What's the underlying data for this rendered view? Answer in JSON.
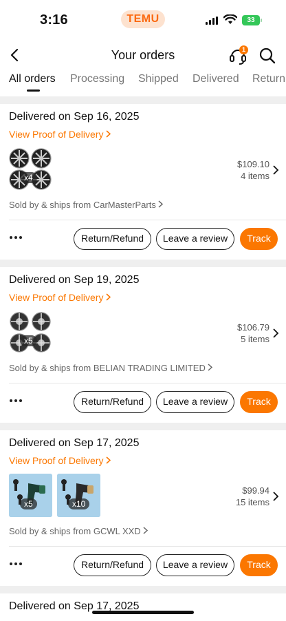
{
  "status": {
    "time": "3:16",
    "brand": "TEMU",
    "battery": "33"
  },
  "header": {
    "title": "Your orders",
    "notification_count": "1"
  },
  "tabs": [
    {
      "label": "All orders",
      "active": true
    },
    {
      "label": "Processing"
    },
    {
      "label": "Shipped"
    },
    {
      "label": "Delivered"
    },
    {
      "label": "Return"
    }
  ],
  "orders": [
    {
      "title": "Delivered on Sep 16, 2025",
      "proof": "View Proof of Delivery",
      "thumbs": [
        {
          "qty": "x4",
          "type": "wheels"
        }
      ],
      "price": "$109.10",
      "items": "4 items",
      "seller": "Sold by & ships from CarMasterParts",
      "actions": {
        "return": "Return/Refund",
        "review": "Leave a review",
        "track": "Track"
      }
    },
    {
      "title": "Delivered on Sep 19, 2025",
      "proof": "View Proof of Delivery",
      "thumbs": [
        {
          "qty": "x5",
          "type": "wheels"
        }
      ],
      "price": "$106.79",
      "items": "5 items",
      "seller": "Sold by & ships from BELIAN TRADING LIMITED",
      "actions": {
        "return": "Return/Refund",
        "review": "Leave a review",
        "track": "Track"
      }
    },
    {
      "title": "Delivered on Sep 17, 2025",
      "proof": "View Proof of Delivery",
      "thumbs": [
        {
          "qty": "x5",
          "type": "massage-gun"
        },
        {
          "qty": "x10",
          "type": "massage-gun"
        }
      ],
      "price": "$99.94",
      "items": "15 items",
      "seller": "Sold by & ships from GCWL XXD",
      "actions": {
        "return": "Return/Refund",
        "review": "Leave a review",
        "track": "Track"
      }
    },
    {
      "title": "Delivered on Sep 17, 2025"
    }
  ],
  "colors": {
    "accent": "#fb7701",
    "brand_pill_bg": "#fde2cf",
    "battery": "#34c759"
  }
}
